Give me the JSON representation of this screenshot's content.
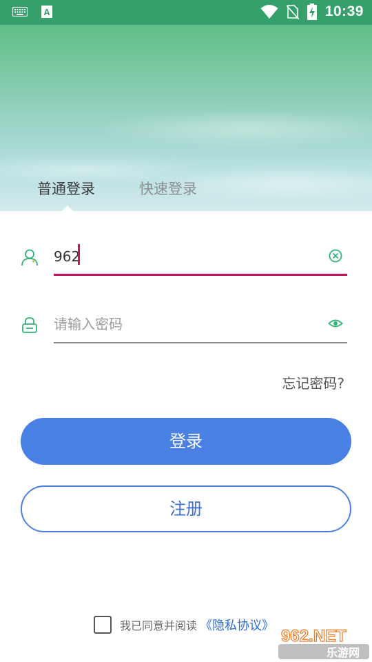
{
  "status_bar": {
    "time": "10:39",
    "icons": [
      "keyboard-icon",
      "a-notification-icon",
      "wifi-icon",
      "no-sim-icon",
      "battery-charging-icon"
    ]
  },
  "tabs": {
    "normal_login": "普通登录",
    "quick_login": "快速登录",
    "active": "normal_login"
  },
  "username": {
    "value": "962",
    "icon": "user-icon",
    "clear_icon": "clear-icon"
  },
  "password": {
    "placeholder": "请输入密码",
    "icon": "lock-icon",
    "toggle_icon": "eye-icon"
  },
  "forgot_password": "忘记密码?",
  "login_button": "登录",
  "register_button": "注册",
  "agreement": {
    "text": "我已同意并阅读",
    "link": "《隐私协议》",
    "checked": false
  },
  "watermark": {
    "top": "962.NET",
    "bottom": "乐游网"
  },
  "colors": {
    "accent": "#4a7fe4",
    "focus_underline": "#c2185b",
    "icon_green": "#2fb574",
    "link": "#2f6fd6"
  }
}
